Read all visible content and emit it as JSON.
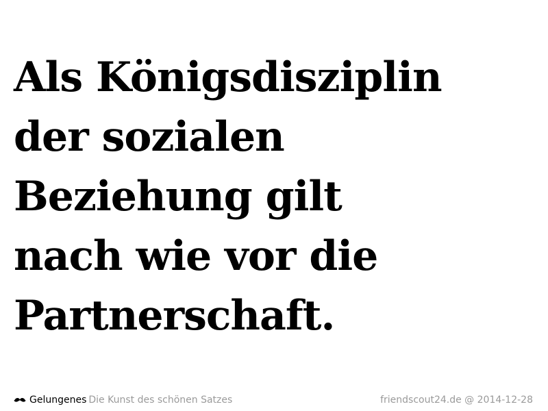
{
  "quote": {
    "lines": [
      "Als Königsdisziplin",
      "der sozialen",
      "Beziehung gilt",
      "nach wie vor die",
      "Partnerschaft."
    ]
  },
  "footer": {
    "logo_icon": "mustache-icon",
    "brand": "Gelungenes",
    "tagline": "Die Kunst des schönen Satzes",
    "source": "friendscout24.de @ 2014-12-28"
  },
  "colors": {
    "text": "#000000",
    "muted": "#9a9a9a",
    "background": "#ffffff"
  }
}
